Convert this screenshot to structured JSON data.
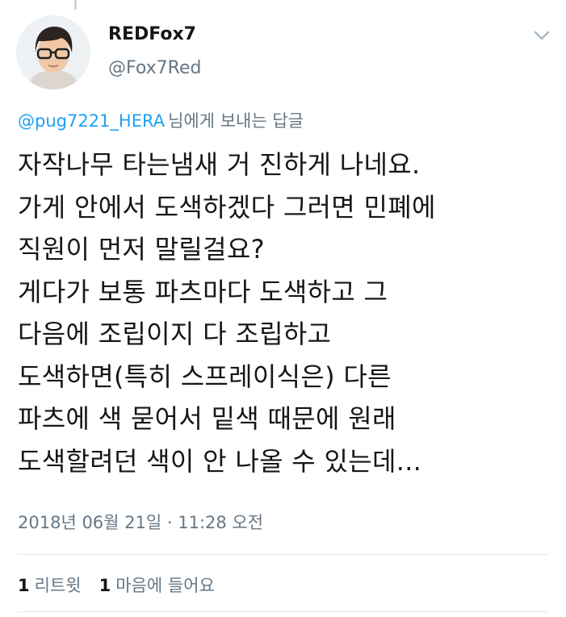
{
  "author": {
    "display_name": "REDFox7",
    "handle": "@Fox7Red",
    "avatar_icon": "person-with-glasses-avatar"
  },
  "reply": {
    "mention": "@pug7221_HERA",
    "suffix": "님에게 보내는 답글"
  },
  "tweet": {
    "lines": [
      "자작나무 타는냄새 거 진하게 나네요.",
      "가게 안에서 도색하겠다 그러면 민폐에",
      "직원이 먼저 말릴걸요?",
      "게다가 보통 파츠마다 도색하고 그",
      "다음에 조립이지 다 조립하고",
      "도색하면(특히 스프레이식은) 다른",
      "파츠에 색 묻어서 밑색 때문에 원래",
      "도색할려던 색이 안 나올 수 있는데..."
    ]
  },
  "timestamp": "2018년 06월 21일 · 11:28 오전",
  "stats": {
    "retweet_count": "1",
    "retweet_label": "리트윗",
    "like_count": "1",
    "like_label": "마음에 들어요"
  },
  "icons": {
    "menu": "chevron-down-icon"
  },
  "colors": {
    "link": "#1da1f2",
    "secondary_text": "#657786",
    "primary_text": "#14171a",
    "divider": "#e1e8ed"
  }
}
